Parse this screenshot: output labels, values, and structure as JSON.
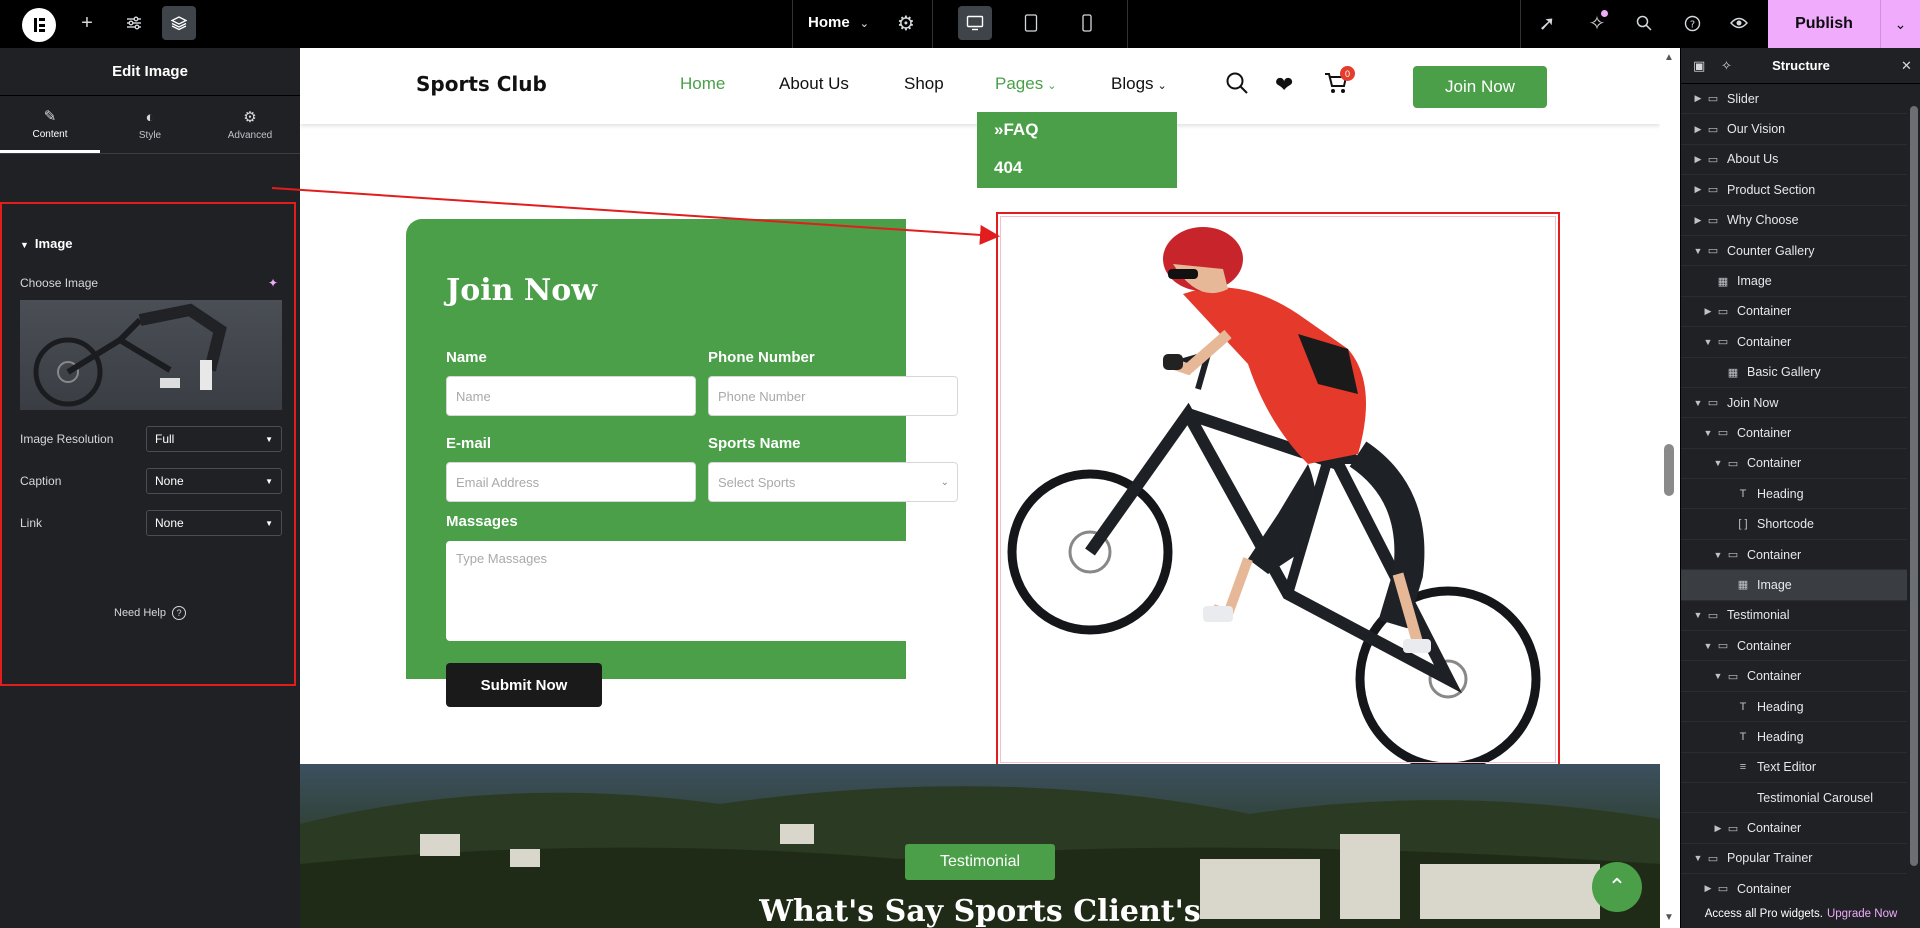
{
  "topbar": {
    "page_name": "Home",
    "publish_label": "Publish"
  },
  "left_panel": {
    "title": "Edit Image",
    "tabs": [
      {
        "label": "Content",
        "icon": "pencil-icon"
      },
      {
        "label": "Style",
        "icon": "contrast-icon"
      },
      {
        "label": "Advanced",
        "icon": "gear-icon"
      }
    ],
    "section_title": "Image",
    "choose_image_label": "Choose Image",
    "controls": [
      {
        "label": "Image Resolution",
        "value": "Full"
      },
      {
        "label": "Caption",
        "value": "None"
      },
      {
        "label": "Link",
        "value": "None"
      }
    ],
    "need_help": "Need Help"
  },
  "site": {
    "logo": "Sports Club",
    "nav": [
      {
        "label": "Home",
        "active": true
      },
      {
        "label": "About Us"
      },
      {
        "label": "Shop"
      },
      {
        "label": "Pages",
        "dropdown": true
      },
      {
        "label": "Blogs",
        "dropdown": true
      }
    ],
    "cart_count": "0",
    "join_button": "Join Now",
    "dropdown_items": [
      "FAQ",
      "404"
    ],
    "accent_color": "#4a9f48"
  },
  "form": {
    "title": "Join Now",
    "name_label": "Name",
    "name_placeholder": "Name",
    "phone_label": "Phone Number",
    "phone_placeholder": "Phone Number",
    "email_label": "E-mail",
    "email_placeholder": "Email Address",
    "sports_label": "Sports Name",
    "sports_placeholder": "Select Sports",
    "message_label": "Massages",
    "message_placeholder": "Type Massages",
    "submit": "Submit Now"
  },
  "testimonial": {
    "badge": "Testimonial",
    "title": "What's Say Sports Client's"
  },
  "structure": {
    "title": "Structure",
    "items": [
      {
        "label": "Slider",
        "depth": 0,
        "caret": "right",
        "icon": "container-icon"
      },
      {
        "label": "Our Vision",
        "depth": 0,
        "caret": "right",
        "icon": "container-icon"
      },
      {
        "label": "About Us",
        "depth": 0,
        "caret": "right",
        "icon": "container-icon"
      },
      {
        "label": "Product Section",
        "depth": 0,
        "caret": "right",
        "icon": "container-icon"
      },
      {
        "label": "Why Choose",
        "depth": 0,
        "caret": "right",
        "icon": "container-icon"
      },
      {
        "label": "Counter Gallery",
        "depth": 0,
        "caret": "down",
        "icon": "container-icon"
      },
      {
        "label": "Image",
        "depth": 1,
        "caret": "",
        "icon": "image-icon"
      },
      {
        "label": "Container",
        "depth": 1,
        "caret": "right",
        "icon": "container-icon"
      },
      {
        "label": "Container",
        "depth": 1,
        "caret": "down",
        "icon": "container-icon"
      },
      {
        "label": "Basic Gallery",
        "depth": 2,
        "caret": "",
        "icon": "gallery-icon"
      },
      {
        "label": "Join Now",
        "depth": 0,
        "caret": "down",
        "icon": "container-icon"
      },
      {
        "label": "Container",
        "depth": 1,
        "caret": "down",
        "icon": "container-icon"
      },
      {
        "label": "Container",
        "depth": 2,
        "caret": "down",
        "icon": "container-icon"
      },
      {
        "label": "Heading",
        "depth": 3,
        "caret": "",
        "icon": "heading-icon"
      },
      {
        "label": "Shortcode",
        "depth": 3,
        "caret": "",
        "icon": "shortcode-icon"
      },
      {
        "label": "Container",
        "depth": 2,
        "caret": "down",
        "icon": "container-icon"
      },
      {
        "label": "Image",
        "depth": 3,
        "caret": "",
        "icon": "image-icon",
        "selected": true
      },
      {
        "label": "Testimonial",
        "depth": 0,
        "caret": "down",
        "icon": "container-icon"
      },
      {
        "label": "Container",
        "depth": 1,
        "caret": "down",
        "icon": "container-icon"
      },
      {
        "label": "Container",
        "depth": 2,
        "caret": "down",
        "icon": "container-icon"
      },
      {
        "label": "Heading",
        "depth": 3,
        "caret": "",
        "icon": "heading-icon"
      },
      {
        "label": "Heading",
        "depth": 3,
        "caret": "",
        "icon": "heading-icon"
      },
      {
        "label": "Text Editor",
        "depth": 3,
        "caret": "",
        "icon": "text-editor-icon"
      },
      {
        "label": "Testimonial Carousel",
        "depth": 3,
        "caret": "",
        "icon": "carousel-icon"
      },
      {
        "label": "Container",
        "depth": 2,
        "caret": "right",
        "icon": "container-icon"
      },
      {
        "label": "Popular Trainer",
        "depth": 0,
        "caret": "down",
        "icon": "container-icon"
      },
      {
        "label": "Container",
        "depth": 1,
        "caret": "right",
        "icon": "container-icon"
      }
    ],
    "footer_text": "Access all Pro widgets.",
    "footer_link": "Upgrade Now"
  }
}
